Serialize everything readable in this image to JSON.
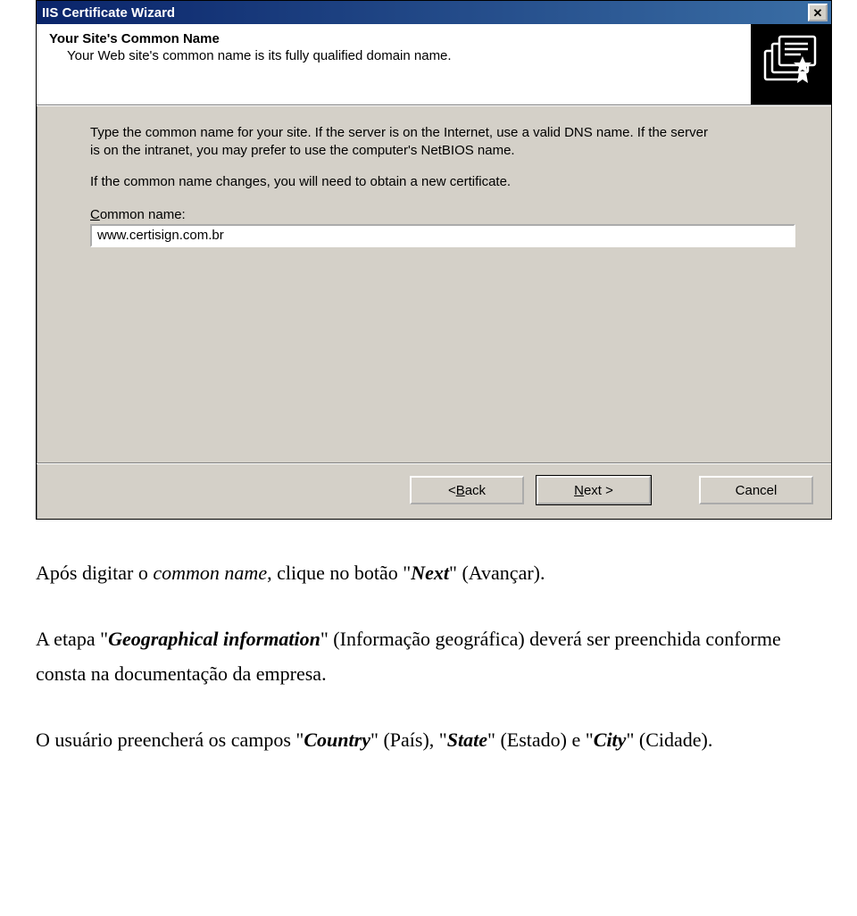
{
  "dialog": {
    "title": "IIS Certificate Wizard",
    "close_glyph": "✕",
    "header": {
      "title": "Your Site's Common Name",
      "subtitle": "Your Web site's common name is its fully qualified domain name."
    },
    "body": {
      "para1": "Type the common name for your site. If the server is on the Internet, use a valid DNS name. If the server is on the intranet, you may prefer to use the computer's NetBIOS name.",
      "para2": "If the common name changes, you will need to obtain a new certificate.",
      "field_label_pre": "C",
      "field_label_post": "ommon name:",
      "field_value": "www.certisign.com.br"
    },
    "buttons": {
      "back_pre": "< ",
      "back_ul": "B",
      "back_post": "ack",
      "next_ul": "N",
      "next_post": "ext >",
      "cancel": "Cancel"
    }
  },
  "doc": {
    "p1_a": "Após digitar o ",
    "p1_i1": "common name",
    "p1_b": ", clique no botão \"",
    "p1_bi": "Next",
    "p1_c": "\" (Avançar).",
    "p2_a": "A etapa \"",
    "p2_bi": "Geographical information",
    "p2_b": "\" (Informação geográfica) deverá ser preenchida conforme consta na documentação da empresa.",
    "p3_a": "O usuário preencherá os campos \"",
    "p3_bi1": "Country",
    "p3_b": "\" (País), \"",
    "p3_bi2": "State",
    "p3_c": "\" (Estado) e \"",
    "p3_bi3": "City",
    "p3_d": "\" (Cidade)."
  }
}
